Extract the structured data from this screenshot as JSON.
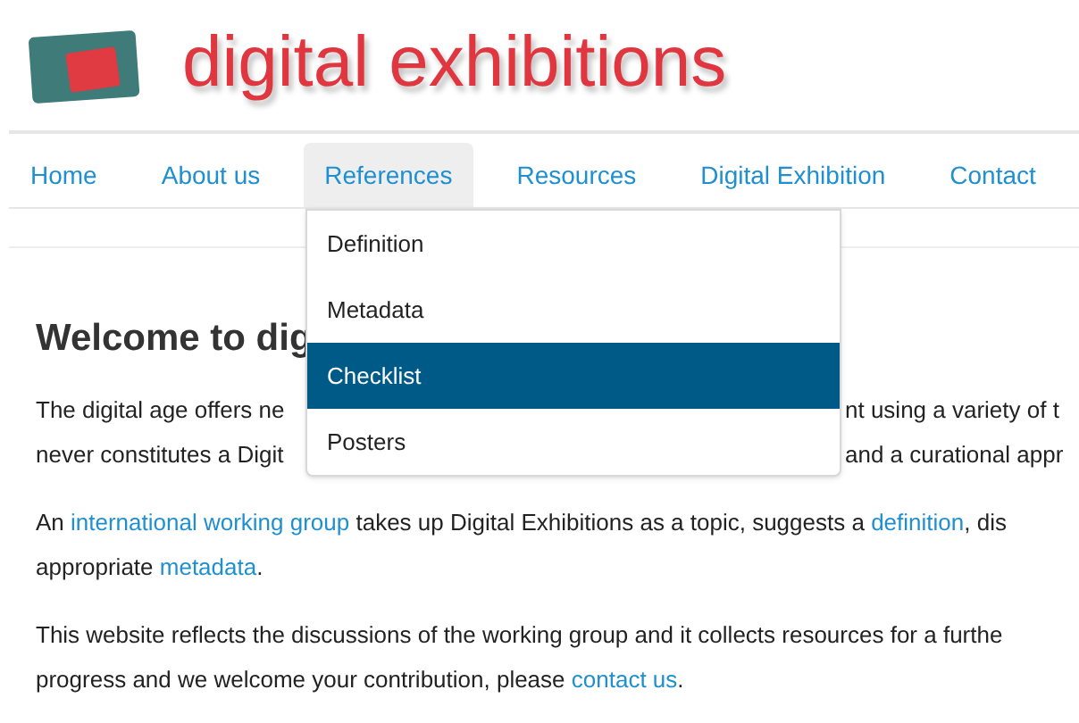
{
  "logo": {
    "title": "digital exhibitions"
  },
  "nav": [
    {
      "label": "Home",
      "selected": false
    },
    {
      "label": "About us",
      "selected": false
    },
    {
      "label": "References",
      "selected": true
    },
    {
      "label": "Resources",
      "selected": false
    },
    {
      "label": "Digital Exhibition",
      "selected": false
    },
    {
      "label": "Contact",
      "selected": false
    }
  ],
  "dropdown": {
    "items": [
      {
        "label": "Definition",
        "selected": false
      },
      {
        "label": "Metadata",
        "selected": false
      },
      {
        "label": "Checklist",
        "selected": true
      },
      {
        "label": "Posters",
        "selected": false
      }
    ]
  },
  "content": {
    "heading": "Welcome to dig",
    "paragraphs": [
      {
        "lines": [
          [
            [
              {
                "kind": "text",
                "text": "The digital age offers ne"
              }
            ],
            [
              {
                "kind": "text",
                "text": "nt using a variety of t"
              }
            ]
          ],
          [
            [
              {
                "kind": "text",
                "text": "never constitutes a Digit"
              }
            ],
            [
              {
                "kind": "text",
                "text": "and a curational appr"
              }
            ]
          ]
        ]
      },
      {
        "lines": [
          [
            [
              {
                "kind": "text",
                "text": "An "
              },
              {
                "kind": "link",
                "text": "international working group"
              },
              {
                "kind": "text",
                "text": " takes up Digital Exhibitions as a topic, suggests a "
              },
              {
                "kind": "link",
                "text": "definition"
              },
              {
                "kind": "text",
                "text": ", dis"
              }
            ]
          ],
          [
            [
              {
                "kind": "text",
                "text": "appropriate "
              },
              {
                "kind": "link",
                "text": "metadata"
              },
              {
                "kind": "text",
                "text": "."
              }
            ]
          ]
        ]
      },
      {
        "lines": [
          [
            [
              {
                "kind": "text",
                "text": "This website reflects the discussions of the working group and it collects resources for a furthe"
              }
            ]
          ],
          [
            [
              {
                "kind": "text",
                "text": "progress and we welcome your contribution, please "
              },
              {
                "kind": "link",
                "text": "contact us"
              },
              {
                "kind": "text",
                "text": "."
              }
            ]
          ]
        ]
      }
    ]
  }
}
